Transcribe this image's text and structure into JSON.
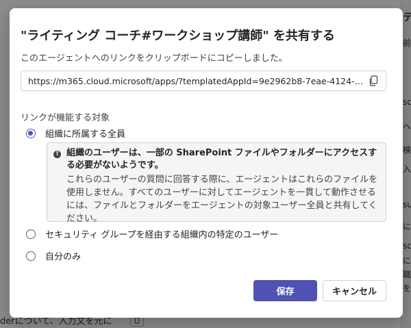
{
  "background": {
    "right_snippets": [
      "テ",
      "前",
      "sc",
      "ヘ",
      "検",
      "入",
      "su",
      "に",
      "sc",
      "に",
      "職",
      "を"
    ],
    "bottom_text": "derについて、入力文を元に"
  },
  "dialog": {
    "title": "\"ライティング コーチ#ワークショップ講師\" を共有する",
    "subtitle": "このエージェントへのリンクをクリップボードにコピーしました。",
    "link_url": "https://m365.cloud.microsoft/apps/?templatedAppId=9e2962b8-7eae-4124-8...",
    "section_label": "リンクが機能する対象",
    "options": [
      {
        "label": "組織に所属する全員",
        "selected": true
      },
      {
        "label": "セキュリティ グループを経由する組織内の特定のユーザー",
        "selected": false
      },
      {
        "label": "自分のみ",
        "selected": false
      }
    ],
    "warning": {
      "icon": "info-icon",
      "title": "組織のユーザーは、一部の SharePoint ファイルやフォルダーにアクセスする必要がないようです。",
      "body": "これらのユーザーの質問に回答する際に、エージェントはこれらのファイルを使用しません。すべてのユーザーに対してエージェントを一貫して動作させるには、ファイルとフォルダーをエージェントの対象ユーザー全員と共有してください。"
    },
    "buttons": {
      "save": "保存",
      "cancel": "キャンセル"
    }
  },
  "colors": {
    "accent": "#4f52b2",
    "overlay": "rgba(0,0,0,0.45)",
    "warning_bg": "#f5f5f5"
  }
}
